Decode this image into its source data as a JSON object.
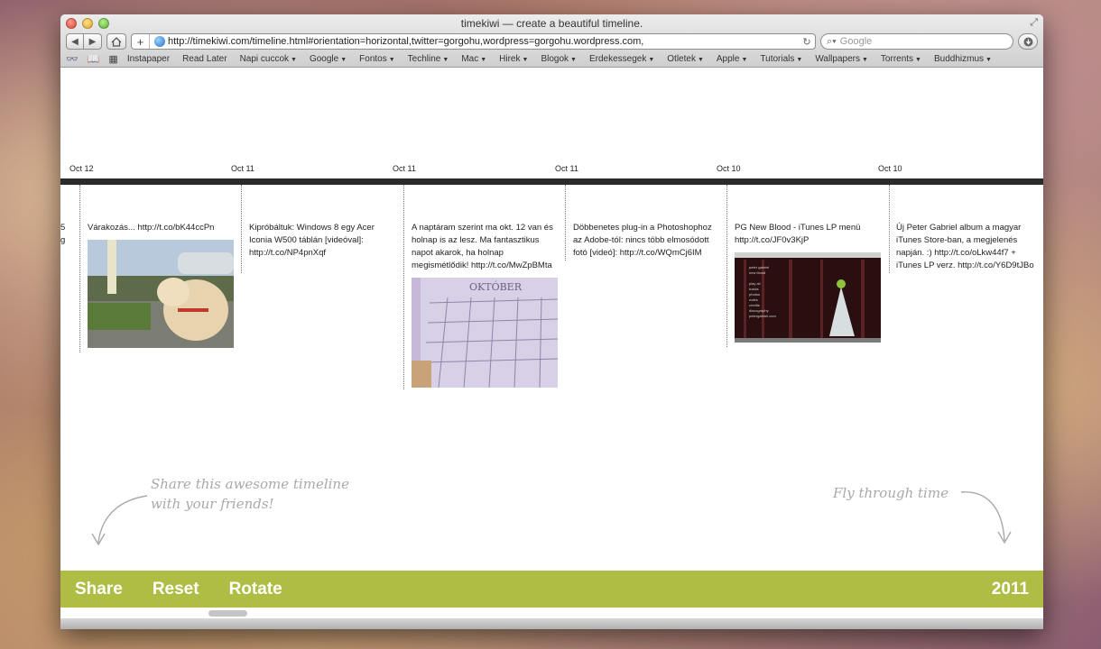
{
  "window": {
    "title": "timekiwi — create a beautiful timeline.",
    "url": "http://timekiwi.com/timeline.html#orientation=horizontal,twitter=gorgohu,wordpress=gorgohu.wordpress.com,",
    "search_placeholder": "Google"
  },
  "bookmarks": [
    {
      "label": "Instapaper",
      "menu": false
    },
    {
      "label": "Read Later",
      "menu": false
    },
    {
      "label": "Napi cuccok",
      "menu": true
    },
    {
      "label": "Google",
      "menu": true
    },
    {
      "label": "Fontos",
      "menu": true
    },
    {
      "label": "Techline",
      "menu": true
    },
    {
      "label": "Mac",
      "menu": true
    },
    {
      "label": "Hirek",
      "menu": true
    },
    {
      "label": "Blogok",
      "menu": true
    },
    {
      "label": "Erdekessegek",
      "menu": true
    },
    {
      "label": "Otletek",
      "menu": true
    },
    {
      "label": "Apple",
      "menu": true
    },
    {
      "label": "Tutorials",
      "menu": true
    },
    {
      "label": "Wallpapers",
      "menu": true
    },
    {
      "label": "Torrents",
      "menu": true
    },
    {
      "label": "Buddhizmus",
      "menu": true
    }
  ],
  "timeline": {
    "dates": [
      "Oct 12",
      "Oct 11",
      "Oct 11",
      "Oct 11",
      "Oct 10",
      "Oct 10"
    ],
    "partial_post_fragments": [
      "5",
      "g"
    ],
    "posts": [
      {
        "text": "Várakozás... http://t.co/bK44ccPn",
        "image": "dog-photo"
      },
      {
        "text": "Kipróbáltuk: Windows 8 egy Acer Iconia W500 táblán [videóval]: http://t.co/NP4pnXqf",
        "image": null
      },
      {
        "text": "A naptáram szerint ma okt. 12 van és holnap is az lesz. Ma fantasztikus napot akarok, ha holnap megismétlődik! http://t.co/MwZpBMta",
        "image": "calendar-photo"
      },
      {
        "text": "Döbbenetes plug-in a Photoshophoz az Adobe-tól: nincs több elmosódott fotó [videó]: http://t.co/WQmCj6IM",
        "image": null
      },
      {
        "text": "PG New Blood - iTunes LP menü http://t.co/JF0v3KjP",
        "image": "itunes-lp-screenshot"
      },
      {
        "text": "Új Peter Gabriel album a magyar iTunes Store-ban, a megjelenés napján. :) http://t.co/oLkw44f7 + iTunes LP verz. http://t.co/Y6D9tJBo",
        "image": null
      }
    ],
    "calendar_month": "OKTÓBER",
    "itunes_menu": [
      "peter gabriel",
      "new blood",
      "",
      "play all",
      "tracks",
      "photos",
      "notes",
      "credits",
      "discography",
      "petergabriel.com"
    ]
  },
  "hints": {
    "share": [
      "Share this awesome timeline",
      "with your friends!"
    ],
    "fly": "Fly through time"
  },
  "footer": {
    "share": "Share",
    "reset": "Reset",
    "rotate": "Rotate",
    "year": "2011"
  },
  "colors": {
    "footer_green": "#afbd45",
    "axis": "#2b2b2b"
  }
}
